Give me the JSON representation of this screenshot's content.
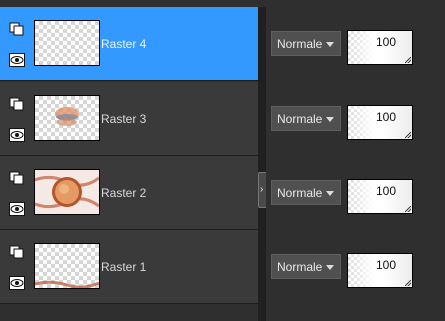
{
  "layers": [
    {
      "name": "Raster 4",
      "selected": true,
      "blend_mode": "Normale",
      "opacity": "100",
      "icons": [
        "layer-link-icon",
        "eye-icon"
      ]
    },
    {
      "name": "Raster 3",
      "selected": false,
      "blend_mode": "Normale",
      "opacity": "100",
      "icons": [
        "layer-link-icon",
        "eye-icon"
      ]
    },
    {
      "name": "Raster 2",
      "selected": false,
      "blend_mode": "Normale",
      "opacity": "100",
      "icons": [
        "layer-link-icon",
        "eye-icon"
      ]
    },
    {
      "name": "Raster 1",
      "selected": false,
      "blend_mode": "Normale",
      "opacity": "100",
      "icons": [
        "layer-link-icon",
        "eye-icon"
      ]
    }
  ],
  "colors": {
    "selected_row": "#3399ff",
    "row_bg": "#3a3a3a",
    "panel_bg": "#2f2f2f"
  }
}
